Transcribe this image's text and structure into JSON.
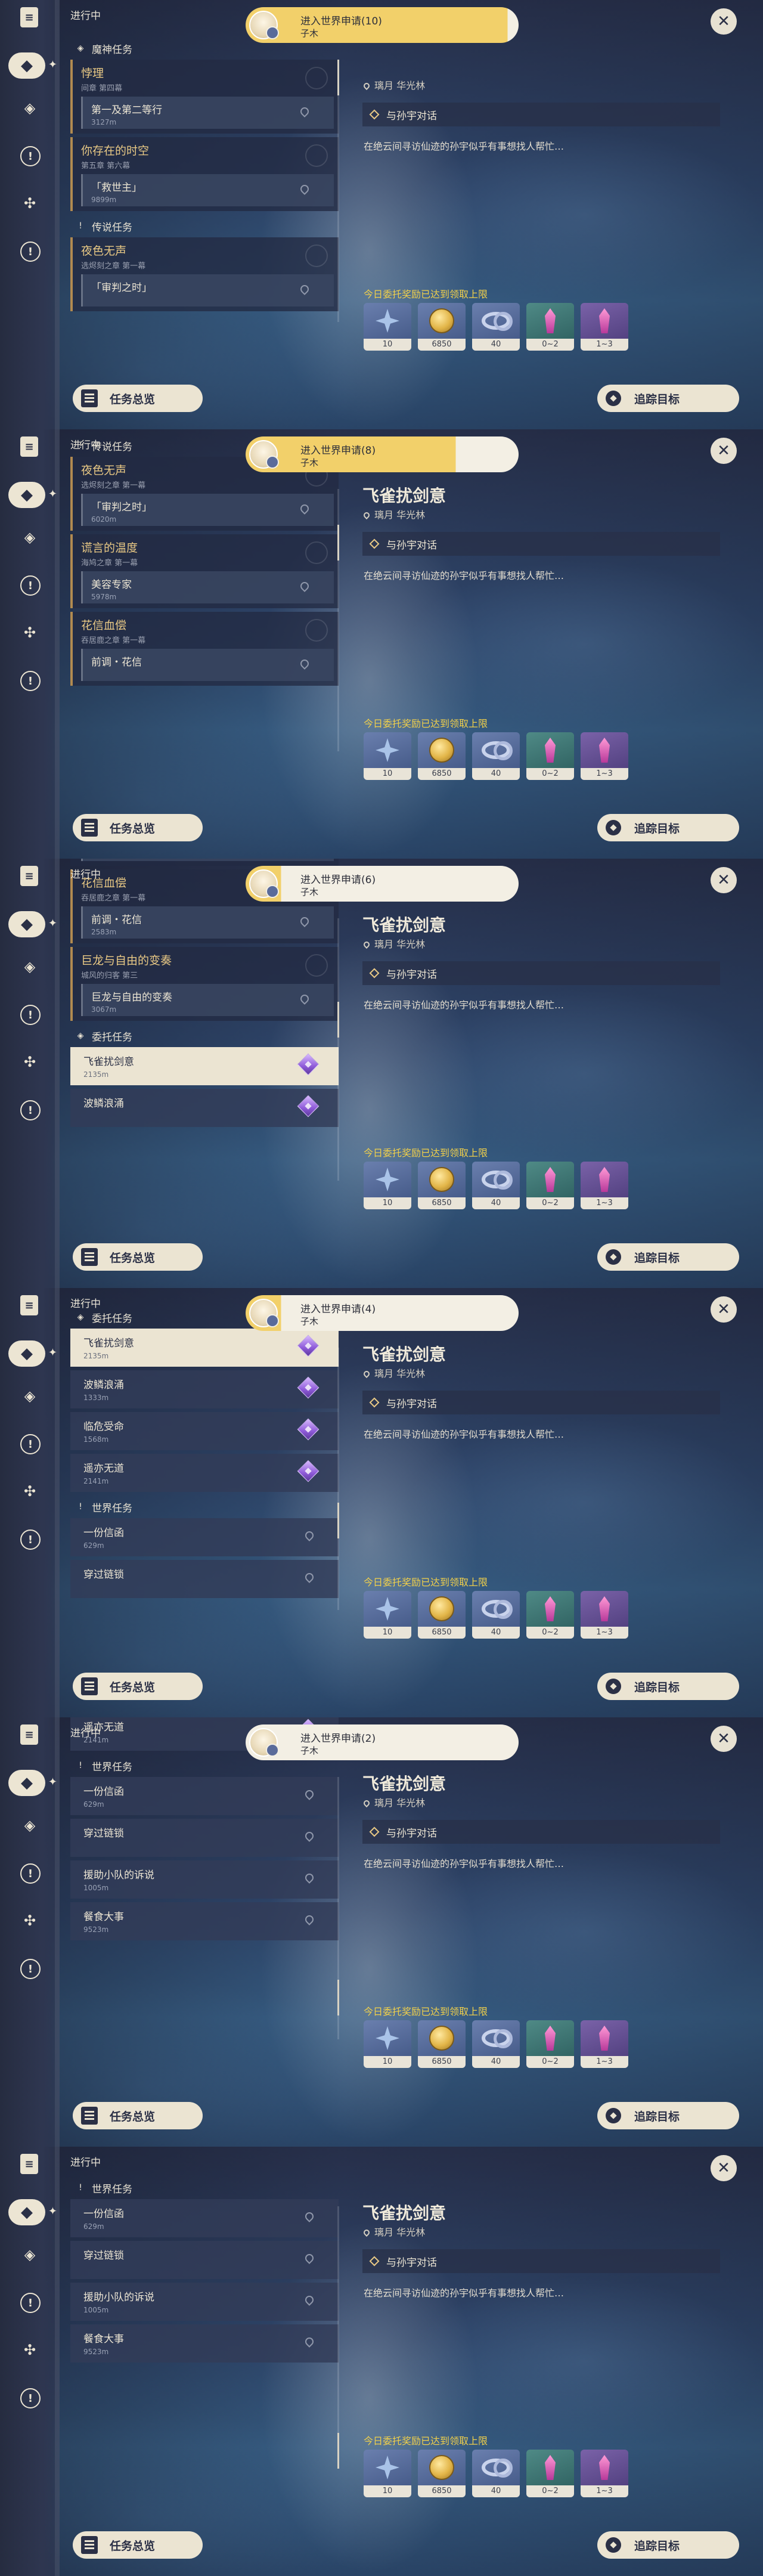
{
  "frames": [
    {
      "status": "进行中",
      "notification": {
        "title": "进入世界申请(10)",
        "subtitle": "子木",
        "fill_percent": 96
      },
      "detail": {
        "title": "",
        "location": "璃月 华光林"
      },
      "list": [
        {
          "kind": "section",
          "icon": "diamond",
          "label": "魔神任务"
        },
        {
          "kind": "group",
          "name": "悖理",
          "sub": "间章 第四幕"
        },
        {
          "kind": "sub",
          "name": "第一及第二等行",
          "dist": "3127m"
        },
        {
          "kind": "group",
          "name": "你存在的时空",
          "sub": "第五章 第六幕"
        },
        {
          "kind": "sub",
          "name": "「救世主」",
          "dist": "9899m"
        },
        {
          "kind": "section",
          "icon": "exclaim",
          "label": "传说任务"
        },
        {
          "kind": "group",
          "name": "夜色无声",
          "sub": "选烬刻之章 第一幕"
        },
        {
          "kind": "sub",
          "name": "「审判之时」",
          "dist": ""
        }
      ]
    },
    {
      "status": "进行中",
      "notification": {
        "title": "进入世界申请(8)",
        "subtitle": "子木",
        "fill_percent": 77
      },
      "detail": {
        "title": "飞雀扰剑意",
        "location": "璃月 华光林"
      },
      "list": [
        {
          "kind": "section",
          "icon": "exclaim",
          "label": "传说任务"
        },
        {
          "kind": "group",
          "name": "夜色无声",
          "sub": "选烬刻之章 第一幕"
        },
        {
          "kind": "sub",
          "name": "「审判之时」",
          "dist": "6020m"
        },
        {
          "kind": "group",
          "name": "谎言的温度",
          "sub": "海鸠之章 第一幕"
        },
        {
          "kind": "sub",
          "name": "美容专家",
          "dist": "5978m"
        },
        {
          "kind": "group",
          "name": "花信血偿",
          "sub": "吞居鹿之章 第一幕"
        },
        {
          "kind": "sub",
          "name": "前调・花信",
          "dist": ""
        }
      ]
    },
    {
      "status": "进行中",
      "notification": {
        "title": "进入世界申请(6)",
        "subtitle": "子木",
        "fill_percent": 13
      },
      "detail": {
        "title": "飞雀扰剑意",
        "location": "璃月 华光林"
      },
      "list": [
        {
          "kind": "sub",
          "name": "美容专家",
          "dist": "5978m"
        },
        {
          "kind": "group",
          "name": "花信血偿",
          "sub": "吞居鹿之章 第一幕"
        },
        {
          "kind": "sub",
          "name": "前调・花信",
          "dist": "2583m"
        },
        {
          "kind": "group",
          "name": "巨龙与自由的变奏",
          "sub": "城风的归客 第三"
        },
        {
          "kind": "sub",
          "name": "巨龙与自由的变奏",
          "dist": "3067m"
        },
        {
          "kind": "section",
          "icon": "diamond",
          "label": "委托任务"
        },
        {
          "kind": "commission",
          "name": "飞雀扰剑意",
          "dist": "2135m",
          "selected": true
        },
        {
          "kind": "commission",
          "name": "波鳞浪涌",
          "dist": ""
        }
      ]
    },
    {
      "status": "进行中",
      "notification": {
        "title": "进入世界申请(4)",
        "subtitle": "子木",
        "fill_percent": 13
      },
      "detail": {
        "title": "飞雀扰剑意",
        "location": "璃月 华光林"
      },
      "list": [
        {
          "kind": "section",
          "icon": "diamond",
          "label": "委托任务"
        },
        {
          "kind": "commission",
          "name": "飞雀扰剑意",
          "dist": "2135m",
          "selected": true
        },
        {
          "kind": "commission",
          "name": "波鳞浪涌",
          "dist": "1333m"
        },
        {
          "kind": "commission",
          "name": "临危受命",
          "dist": "1568m"
        },
        {
          "kind": "commission",
          "name": "遥亦无道",
          "dist": "2141m"
        },
        {
          "kind": "section",
          "icon": "exclaim",
          "label": "世界任务"
        },
        {
          "kind": "world",
          "name": "一份信函",
          "dist": "629m"
        },
        {
          "kind": "world",
          "name": "穿过链锁",
          "dist": ""
        }
      ]
    },
    {
      "status": "进行中",
      "notification": {
        "title": "进入世界申请(2)",
        "subtitle": "子木",
        "fill_percent": 0
      },
      "detail": {
        "title": "飞雀扰剑意",
        "location": "璃月 华光林"
      },
      "list": [
        {
          "kind": "commission",
          "name": "遥亦无道",
          "dist": "2141m"
        },
        {
          "kind": "section",
          "icon": "exclaim",
          "label": "世界任务"
        },
        {
          "kind": "world",
          "name": "一份信函",
          "dist": "629m"
        },
        {
          "kind": "world",
          "name": "穿过链锁",
          "dist": ""
        },
        {
          "kind": "world",
          "name": "援助小队的诉说",
          "dist": "1005m"
        },
        {
          "kind": "world",
          "name": "餐食大事",
          "dist": "9523m"
        }
      ]
    },
    {
      "status": "进行中",
      "notification": null,
      "detail": {
        "title": "飞雀扰剑意",
        "location": "璃月 华光林"
      },
      "list": [
        {
          "kind": "section",
          "icon": "exclaim",
          "label": "世界任务"
        },
        {
          "kind": "world",
          "name": "一份信函",
          "dist": "629m"
        },
        {
          "kind": "world",
          "name": "穿过链锁",
          "dist": ""
        },
        {
          "kind": "world",
          "name": "援助小队的诉说",
          "dist": "1005m"
        },
        {
          "kind": "world",
          "name": "餐食大事",
          "dist": "9523m"
        }
      ]
    }
  ],
  "common": {
    "step_text": "与孙宇对话",
    "description": "在绝云间寻访仙迹的孙宇似乎有事想找人帮忙…",
    "reward_header": "今日委托奖励已达到领取上限",
    "rewards": [
      {
        "icon": "star-icon",
        "count": "10",
        "bg": "blue"
      },
      {
        "icon": "mora-coin-icon",
        "count": "6850",
        "bg": "blue"
      },
      {
        "icon": "companionship-ring-icon",
        "count": "40",
        "bg": "blue"
      },
      {
        "icon": "crystal-icon",
        "count": "0~2",
        "bg": "green"
      },
      {
        "icon": "crystal-icon",
        "count": "1~3",
        "bg": "violet"
      }
    ],
    "overview_button": "任务总览",
    "track_button": "追踪目标"
  }
}
